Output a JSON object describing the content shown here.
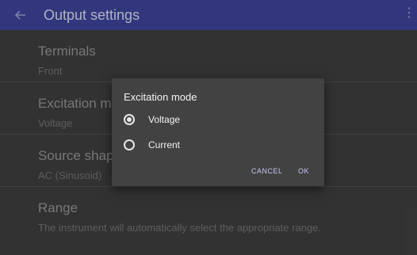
{
  "appbar": {
    "title": "Output settings",
    "back_icon": "arrow-left-icon",
    "overflow_icon": "more-vert-icon"
  },
  "settings": [
    {
      "label": "Terminals",
      "value": "Front"
    },
    {
      "label": "Excitation mode",
      "value": "Voltage"
    },
    {
      "label": "Source shape",
      "value": "AC (Sinusoid)"
    },
    {
      "label": "Range",
      "value": "The instrument will automatically select the appropriate range."
    }
  ],
  "dialog": {
    "title": "Excitation mode",
    "options": [
      {
        "label": "Voltage",
        "selected": true
      },
      {
        "label": "Current",
        "selected": false
      }
    ],
    "cancel_label": "CANCEL",
    "ok_label": "OK"
  },
  "colors": {
    "appbar": "#3a3f8f",
    "accent": "#c5c8f4",
    "dialog_bg": "#424242",
    "background": "#3a3a3a"
  }
}
